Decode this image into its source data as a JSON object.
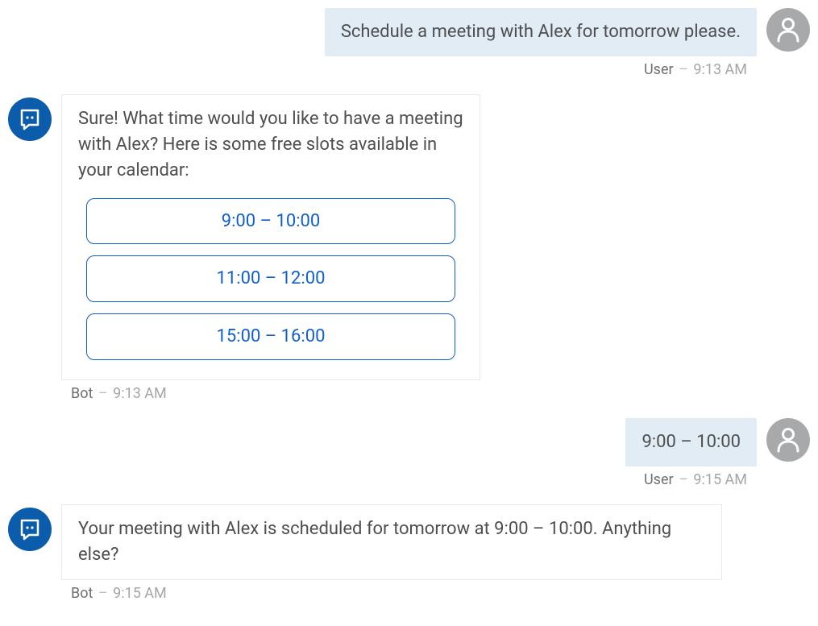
{
  "colors": {
    "user_bubble_bg": "#e1ecf4",
    "bot_avatar_bg": "#0b5cab",
    "user_avatar_bg": "#a8a9ab",
    "option_border": "#1060c9"
  },
  "messages": {
    "msg1": {
      "sender": "User",
      "time": "9:13 AM",
      "text": "Schedule a meeting with Alex for tomorrow please."
    },
    "msg2": {
      "sender": "Bot",
      "time": "9:13 AM",
      "text": "Sure! What time would you like to have a meeting with Alex? Here is some free slots available in your calendar:",
      "options": {
        "opt1": "9:00 – 10:00",
        "opt2": "11:00 – 12:00",
        "opt3": "15:00 – 16:00"
      }
    },
    "msg3": {
      "sender": "User",
      "time": "9:15 AM",
      "text": "9:00 – 10:00"
    },
    "msg4": {
      "sender": "Bot",
      "time": "9:15 AM",
      "text": "Your meeting with Alex is scheduled for tomorrow at 9:00 – 10:00. Anything else?"
    }
  }
}
